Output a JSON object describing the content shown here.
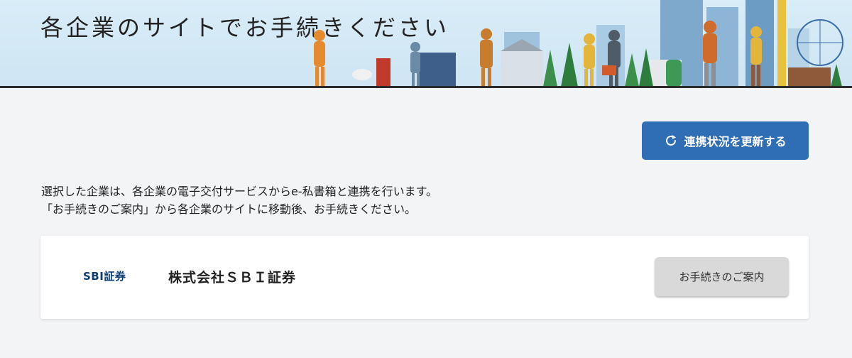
{
  "hero": {
    "title": "各企業のサイトでお手続きください"
  },
  "actions": {
    "update_label": "連携状況を更新する"
  },
  "info": {
    "line1": "選択した企業は、各企業の電子交付サービスからe-私書箱と連携を行います。",
    "line2": "「お手続きのご案内」から各企業のサイトに移動後、お手続きください。"
  },
  "companies": [
    {
      "logo_text": "SBI証券",
      "name": "株式会社ＳＢＩ証券",
      "guide_label": "お手続きのご案内"
    }
  ],
  "colors": {
    "primary": "#2f6db5",
    "background": "#f3f4f6",
    "logo": "#0b3d74"
  },
  "icons": {
    "update": "refresh-icon"
  }
}
